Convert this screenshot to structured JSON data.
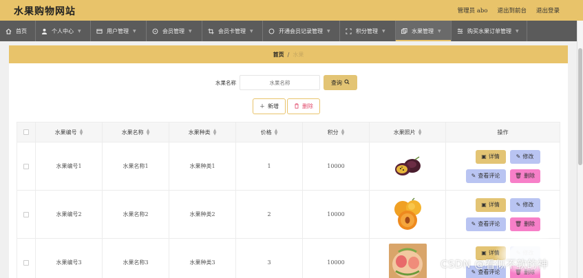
{
  "header": {
    "title": "水果购物网站",
    "admin_label": "管理员 abo",
    "front_label": "退出到前台",
    "logout_label": "退出登录"
  },
  "nav": {
    "items": [
      {
        "label": "首页",
        "icon": "home-icon",
        "dropdown": false
      },
      {
        "label": "个人中心",
        "icon": "user-icon",
        "dropdown": true
      },
      {
        "label": "用户管理",
        "icon": "users-icon",
        "dropdown": true
      },
      {
        "label": "会员管理",
        "icon": "vip-icon",
        "dropdown": true
      },
      {
        "label": "会员卡管理",
        "icon": "crop-icon",
        "dropdown": true
      },
      {
        "label": "开通会员记录管理",
        "icon": "record-icon",
        "dropdown": true
      },
      {
        "label": "积分管理",
        "icon": "points-icon",
        "dropdown": true
      },
      {
        "label": "水果管理",
        "icon": "fruit-icon",
        "dropdown": true,
        "active": true
      },
      {
        "label": "购买水果订单管理",
        "icon": "order-icon",
        "dropdown": true
      }
    ]
  },
  "breadcrumb": {
    "home": "首页",
    "separator": "/",
    "current": "水果"
  },
  "search": {
    "label": "水果名称",
    "placeholder": "水果名称",
    "button": "查询"
  },
  "actions": {
    "add": "新增",
    "delete": "删除"
  },
  "table": {
    "headers": [
      "水果编号",
      "水果名称",
      "水果种类",
      "价格",
      "积分",
      "水果照片",
      "操作"
    ],
    "rows": [
      {
        "id": "水果编号1",
        "name": "水果名称1",
        "type": "水果种类1",
        "price": "1",
        "points": "10000",
        "photo": "passion-fruit"
      },
      {
        "id": "水果编号2",
        "name": "水果名称2",
        "type": "水果种类2",
        "price": "2",
        "points": "10000",
        "photo": "apricot"
      },
      {
        "id": "水果编号3",
        "name": "水果名称3",
        "type": "水果种类3",
        "price": "3",
        "points": "10000",
        "photo": "carved-melon"
      }
    ],
    "row_actions": {
      "detail": "详情",
      "edit": "修改",
      "review": "查看评论",
      "remove": "删除"
    }
  },
  "watermark": "CSDN @看似不软的神",
  "colors": {
    "accent": "#e8c36a",
    "nav": "#5b5b5b",
    "edit": "#b9c4f2",
    "remove": "#f77fc8"
  }
}
